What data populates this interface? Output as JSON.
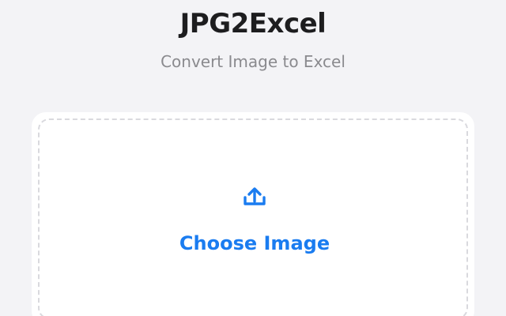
{
  "header": {
    "title": "JPG2Excel",
    "subtitle": "Convert Image to Excel"
  },
  "upload": {
    "icon": "upload-icon",
    "button_label": "Choose Image"
  },
  "colors": {
    "background": "#f3f3f6",
    "card": "#ffffff",
    "accent": "#1a7cf0",
    "title": "#1d1d1f",
    "subtitle": "#8a8a8e",
    "dashed_border": "#d9d9de"
  }
}
